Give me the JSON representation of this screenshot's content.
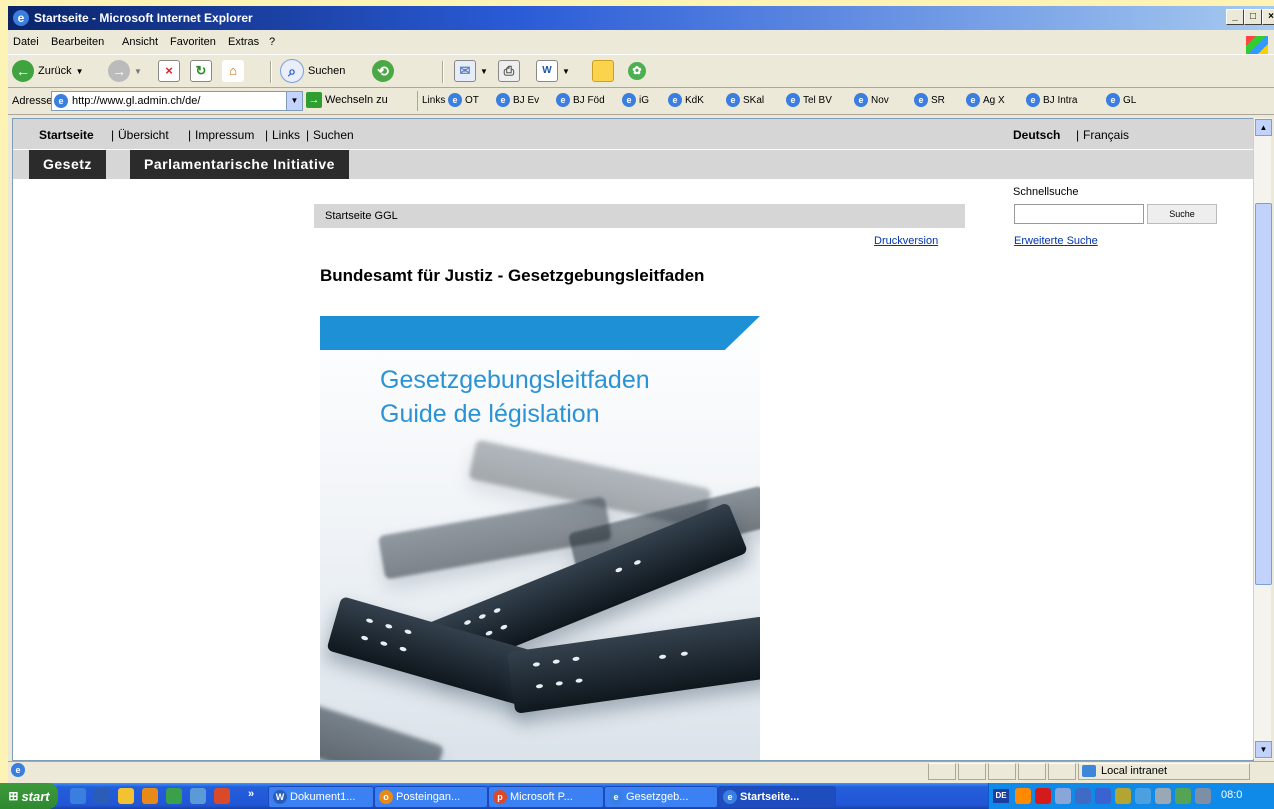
{
  "window": {
    "title": "Startseite - Microsoft Internet Explorer"
  },
  "menu": [
    "Datei",
    "Bearbeiten",
    "Ansicht",
    "Favoriten",
    "Extras",
    "?"
  ],
  "toolbar": {
    "back": "Zurück",
    "search": "Suchen"
  },
  "address": {
    "label": "Adresse",
    "url": "http://www.gl.admin.ch/de/",
    "go": "Wechseln zu",
    "links_label": "Links"
  },
  "links": [
    "OT",
    "BJ Ev",
    "BJ Föd",
    "iG",
    "KdK",
    "SKal",
    "Tel BV",
    "Nov",
    "SR",
    "Ag X",
    "BJ Intra",
    "GL"
  ],
  "page": {
    "topnav": [
      "Startseite",
      "Übersicht",
      "Impressum",
      "Links",
      "Suchen"
    ],
    "lang_active": "Deutsch",
    "lang_other": "Français",
    "tabs": [
      "Gesetz",
      "Parlamentarische Initiative"
    ],
    "quicksearch_label": "Schnellsuche",
    "search_button": "Suche",
    "advanced_search": "Erweiterte Suche",
    "breadcrumb": "Startseite GGL",
    "print": "Druckversion",
    "heading": "Bundesamt für Justiz - Gesetzgebungsleitfaden",
    "cover_line1": "Gesetzgebungsleitfaden",
    "cover_line2": "Guide de législation"
  },
  "status": {
    "zone": "Local intranet"
  },
  "taskbar": {
    "start": "start",
    "items": [
      "Dokument1...",
      "Posteingan...",
      "Microsoft P...",
      "Gesetzgeb...",
      "Startseite..."
    ],
    "lang": "DE",
    "clock": "08:0"
  },
  "colors": {
    "accent": "#1e90d6",
    "tab_bg": "#2b2b2b",
    "nav_bg": "#d6d6d6",
    "link": "#0033aa"
  }
}
